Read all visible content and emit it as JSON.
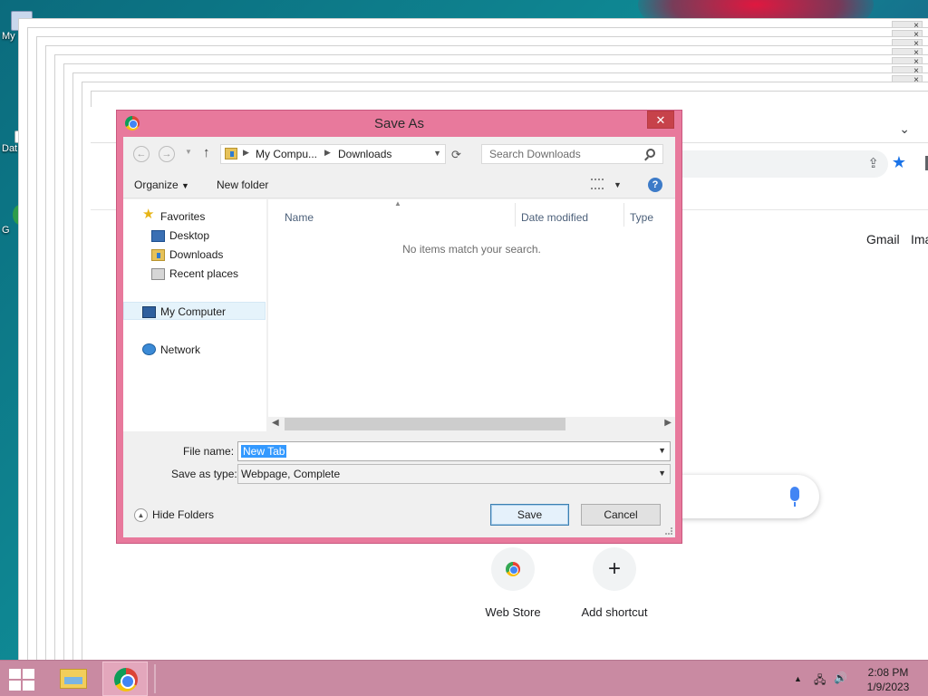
{
  "desktop": {
    "icons": [
      {
        "label": "My"
      },
      {
        "label": "Dat"
      },
      {
        "label": "G"
      }
    ]
  },
  "chrome": {
    "top_links": [
      "Gmail",
      "Ima"
    ],
    "shortcuts": [
      {
        "label": "Web Store",
        "icon": "chrome-web-store-icon"
      },
      {
        "label": "Add shortcut",
        "icon": "plus-icon"
      }
    ]
  },
  "dialog": {
    "title": "Save As",
    "close_glyph": "✕",
    "breadcrumbs": [
      "My Compu...",
      "Downloads"
    ],
    "search_placeholder": "Search Downloads",
    "toolbar": {
      "organize": "Organize",
      "new_folder": "New folder"
    },
    "nav": {
      "favorites": "Favorites",
      "favorites_items": [
        "Desktop",
        "Downloads",
        "Recent places"
      ],
      "computer": "My Computer",
      "network": "Network"
    },
    "columns": [
      "Name",
      "Date modified",
      "Type"
    ],
    "empty_message": "No items match your search.",
    "file_name_label": "File name:",
    "file_name_value": "New Tab",
    "save_type_label": "Save as type:",
    "save_type_value": "Webpage, Complete",
    "hide_folders": "Hide Folders",
    "save_button": "Save",
    "cancel_button": "Cancel"
  },
  "taskbar": {
    "clock_time": "2:08 PM",
    "clock_date": "1/9/2023"
  }
}
